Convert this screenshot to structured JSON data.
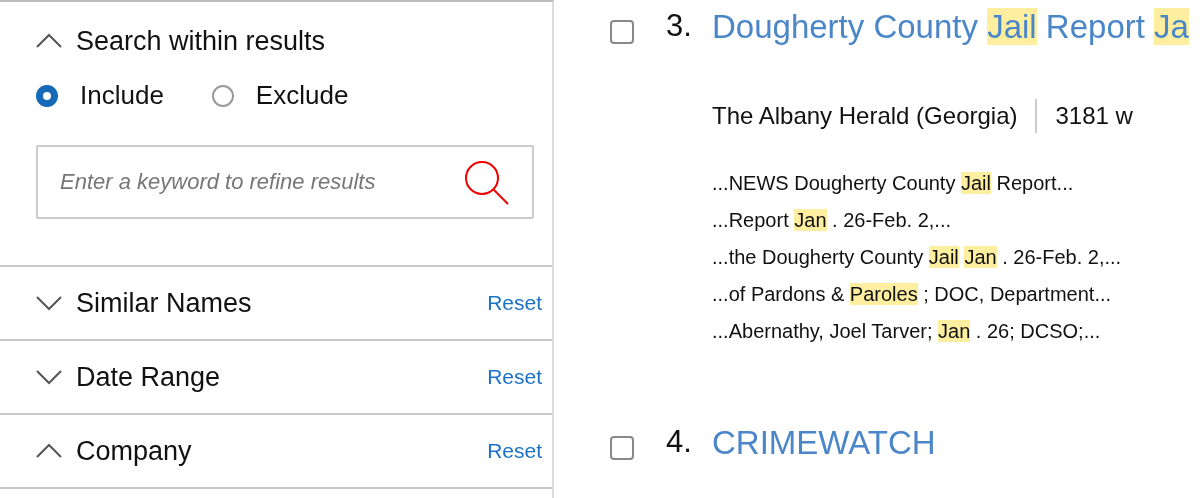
{
  "sidebar": {
    "sections": [
      {
        "kind": "search",
        "title": "Search within results",
        "expanded": true,
        "options": [
          {
            "label": "Include",
            "selected": true
          },
          {
            "label": "Exclude",
            "selected": false
          }
        ],
        "search": {
          "placeholder": "Enter a keyword to refine results"
        }
      },
      {
        "kind": "filter",
        "title": "Similar Names",
        "expanded": false,
        "reset": "Reset"
      },
      {
        "kind": "filter",
        "title": "Date Range",
        "expanded": false,
        "reset": "Reset"
      },
      {
        "kind": "filter",
        "title": "Company",
        "expanded": true,
        "reset": "Reset"
      }
    ]
  },
  "results": [
    {
      "number": "3.",
      "checked": false,
      "title": [
        {
          "text": "Dougherty County ",
          "highlight": false
        },
        {
          "text": "Jail",
          "highlight": true
        },
        {
          "text": " Report ",
          "highlight": false
        },
        {
          "text": "Ja",
          "highlight": true
        }
      ],
      "source": "The Albany Herald (Georgia)",
      "words": "3181 w",
      "snippets": [
        [
          {
            "text": "...NEWS Dougherty County ",
            "highlight": false
          },
          {
            "text": "Jail",
            "highlight": true
          },
          {
            "text": " Report...",
            "highlight": false
          }
        ],
        [
          {
            "text": "...Report ",
            "highlight": false
          },
          {
            "text": "Jan",
            "highlight": true
          },
          {
            "text": " . 26-Feb. 2,...",
            "highlight": false
          }
        ],
        [
          {
            "text": "...the Dougherty County ",
            "highlight": false
          },
          {
            "text": "Jail",
            "highlight": true
          },
          {
            "text": "Jan",
            "highlight": true
          },
          {
            "text": " . 26-Feb. 2,...",
            "highlight": false
          }
        ],
        [
          {
            "text": "...of Pardons & ",
            "highlight": false
          },
          {
            "text": "Paroles",
            "highlight": true
          },
          {
            "text": " ; DOC, Department...",
            "highlight": false
          }
        ],
        [
          {
            "text": "...Abernathy, Joel Tarver; ",
            "highlight": false
          },
          {
            "text": "Jan",
            "highlight": true
          },
          {
            "text": " . 26; DCSO;...",
            "highlight": false
          }
        ]
      ]
    },
    {
      "number": "4.",
      "checked": false,
      "title": [
        {
          "text": "CRIMEWATCH",
          "highlight": false
        }
      ]
    }
  ]
}
